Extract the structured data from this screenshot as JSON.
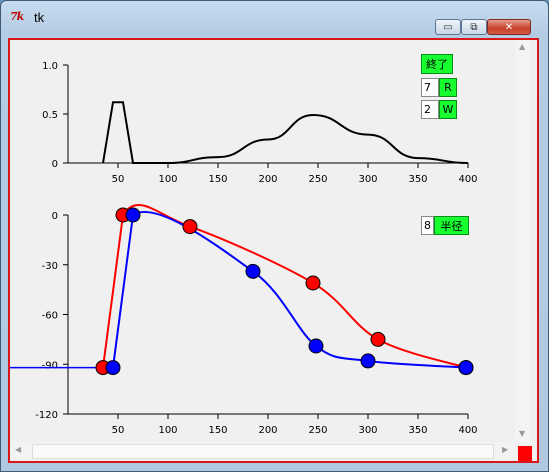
{
  "window": {
    "title": "tk",
    "icon_glyph": "7k"
  },
  "titlebar_buttons": {
    "minimize": "▭",
    "maximize": "⧉",
    "close": "✕"
  },
  "controls": {
    "quit_label": "終了",
    "r_value": "7",
    "r_label": "R",
    "w_value": "2",
    "w_label": "W",
    "radius_value": "8",
    "radius_label": "半径"
  },
  "colors": {
    "red_series": "#ff0000",
    "blue_series": "#0000ff",
    "button_green": "#18ff30"
  },
  "chart_data": [
    {
      "type": "line",
      "xlim": [
        0,
        400
      ],
      "ylim": [
        0,
        1.0
      ],
      "xticks": [
        "50",
        "100",
        "150",
        "200",
        "250",
        "300",
        "350",
        "400"
      ],
      "yticks": [
        "1.0",
        "0.5",
        "0"
      ],
      "grid": false,
      "series": [
        {
          "x": [
            35,
            45,
            55,
            65,
            100,
            150,
            200,
            245,
            300,
            350,
            400
          ],
          "y": [
            0,
            0.62,
            0.62,
            0,
            0,
            0.06,
            0.24,
            0.49,
            0.29,
            0.05,
            0
          ]
        }
      ]
    },
    {
      "type": "line",
      "xlim": [
        0,
        400
      ],
      "ylim": [
        -120,
        0
      ],
      "xticks": [
        "50",
        "100",
        "150",
        "200",
        "250",
        "300",
        "350",
        "400"
      ],
      "yticks": [
        "0",
        "-30",
        "-60",
        "-90",
        "-120"
      ],
      "grid": false,
      "series": [
        {
          "color": "red",
          "x": [
            35,
            55,
            122,
            245,
            310,
            398
          ],
          "y": [
            -92,
            0,
            -7,
            -41,
            -75,
            -92
          ]
        },
        {
          "color": "blue",
          "x": [
            45,
            65,
            185,
            248,
            300,
            398
          ],
          "y": [
            -92,
            0,
            -34,
            -79,
            -88,
            -92
          ]
        }
      ],
      "baseline": {
        "x": [
          0,
          35
        ],
        "y": [
          -92,
          -92
        ]
      }
    }
  ]
}
